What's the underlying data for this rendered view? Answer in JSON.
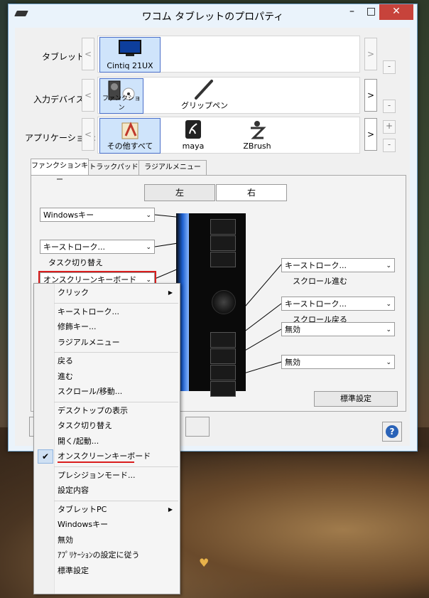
{
  "window": {
    "title": "ワコム タブレットのプロパティ",
    "min": "–",
    "max": "□",
    "close": "✕"
  },
  "rows": {
    "tablet": {
      "label": "タブレット:",
      "items": [
        "Cintiq 21UX"
      ]
    },
    "input": {
      "label": "入力デバイス:",
      "items": [
        "ファンクション",
        "グリップペン"
      ]
    },
    "app": {
      "label": "アプリケーション:",
      "items": [
        "その他すべて",
        "maya",
        "ZBrush"
      ]
    }
  },
  "nav": {
    "prev": "<",
    "next": ">",
    "add": "+",
    "remove": "-"
  },
  "tabs": [
    "ファンクションキー",
    "トラックパッド",
    "ラジアルメニュー"
  ],
  "sides": {
    "left": "左",
    "right": "右"
  },
  "left_dropdowns": [
    {
      "value": "Windowsキー",
      "sub": ""
    },
    {
      "value": "キーストローク...",
      "sub": "タスク切り替え"
    },
    {
      "value": "オンスクリーンキーボード",
      "sub": ""
    }
  ],
  "right_dropdowns": [
    {
      "value": "キーストローク...",
      "sub": "スクロール進む"
    },
    {
      "value": "キーストローク...",
      "sub": "スクロール戻る"
    },
    {
      "value": "無効",
      "sub": ""
    },
    {
      "value": "無効",
      "sub": ""
    }
  ],
  "buttons": {
    "default": "標準設定",
    "help": "?"
  },
  "menu": [
    {
      "label": "クリック",
      "submenu": true
    },
    {
      "sep": true
    },
    {
      "label": "キーストローク..."
    },
    {
      "label": "修飾キー..."
    },
    {
      "label": "ラジアルメニュー"
    },
    {
      "sep": true
    },
    {
      "label": "戻る"
    },
    {
      "label": "進む"
    },
    {
      "label": "スクロール/移動..."
    },
    {
      "sep": true
    },
    {
      "label": "デスクトップの表示"
    },
    {
      "label": "タスク切り替え"
    },
    {
      "label": "開く/起動..."
    },
    {
      "label": "オンスクリーンキーボード",
      "checked": true
    },
    {
      "sep": true
    },
    {
      "label": "プレシジョンモード..."
    },
    {
      "label": "設定内容"
    },
    {
      "sep": true
    },
    {
      "label": "タブレットPC",
      "submenu": true
    },
    {
      "label": "Windowsキー"
    },
    {
      "label": "無効"
    },
    {
      "label": "ｱﾌﾟﾘｹｰｼｮﾝの設定に従う"
    },
    {
      "label": "標準設定"
    }
  ],
  "colors": {
    "accent": "#2a63b8",
    "highlight": "#d91e1e",
    "selection": "#cfe4fb"
  }
}
